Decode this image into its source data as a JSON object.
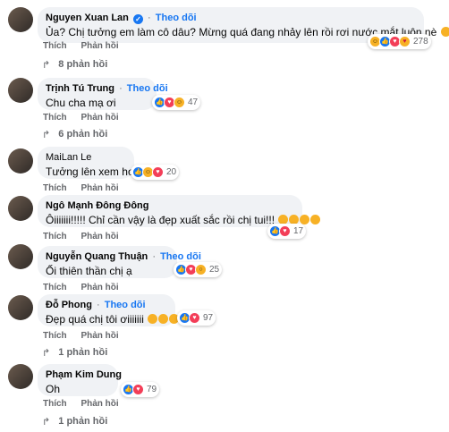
{
  "comments": [
    {
      "name": "Nguyen Xuan Lan",
      "verified": true,
      "follow": "Theo dõi",
      "text": "Ủa? Chị tưởng em làm cô dâu? Mừng quá đang nhảy lên rồi rơi nước mắt luôn nè",
      "text_emojis": [
        "care"
      ],
      "reactions": [
        "haha",
        "like",
        "love",
        "care"
      ],
      "reaction_count": "278",
      "actions": [
        "Thích",
        "Phản hồi"
      ],
      "replies": "8 phản hồi"
    },
    {
      "name": "Trịnh Tú Trung",
      "verified": false,
      "follow": "Theo dõi",
      "text": "Chu cha mạ ơi",
      "reactions": [
        "like",
        "love",
        "haha"
      ],
      "reaction_count": "47",
      "actions": [
        "Thích",
        "Phản hồi"
      ],
      "replies": "6 phản hồi"
    },
    {
      "name": "MaiLan Le",
      "verified": false,
      "follow": "",
      "text": "Tưởng lên xem hoa",
      "reactions": [
        "like",
        "haha",
        "love"
      ],
      "reaction_count": "20",
      "actions": [
        "Thích",
        "Phản hồi"
      ],
      "replies": ""
    },
    {
      "name": "Ngô Mạnh Đông Đông",
      "verified": false,
      "follow": "",
      "text": "Ôiiiiiii!!!!! Chỉ cần vậy là đẹp xuất sắc rồi chị tui!!!",
      "text_emojis": [
        "care",
        "care",
        "care",
        "care"
      ],
      "reactions": [
        "like",
        "love"
      ],
      "reaction_count": "17",
      "actions": [
        "Thích",
        "Phản hồi"
      ],
      "replies": ""
    },
    {
      "name": "Nguyễn Quang Thuận",
      "verified": false,
      "follow": "Theo dõi",
      "text": "Ối thiên thần chị ạ",
      "reactions": [
        "like",
        "love",
        "wow"
      ],
      "reaction_count": "25",
      "actions": [
        "Thích",
        "Phản hồi"
      ],
      "replies": ""
    },
    {
      "name": "Đỗ Phong",
      "verified": false,
      "follow": "Theo dõi",
      "text": "Đẹp quá chị tôi ơiiiiiii",
      "text_emojis": [
        "love",
        "love",
        "love"
      ],
      "reactions": [
        "like",
        "love"
      ],
      "reaction_count": "97",
      "actions": [
        "Thích",
        "Phản hồi"
      ],
      "replies": "1 phản hồi"
    },
    {
      "name": "Phạm Kim Dung",
      "verified": false,
      "follow": "",
      "text": "Oh",
      "reactions": [
        "like",
        "love"
      ],
      "reaction_count": "79",
      "actions": [
        "Thích",
        "Phản hồi"
      ],
      "replies": "1 phản hồi"
    }
  ]
}
